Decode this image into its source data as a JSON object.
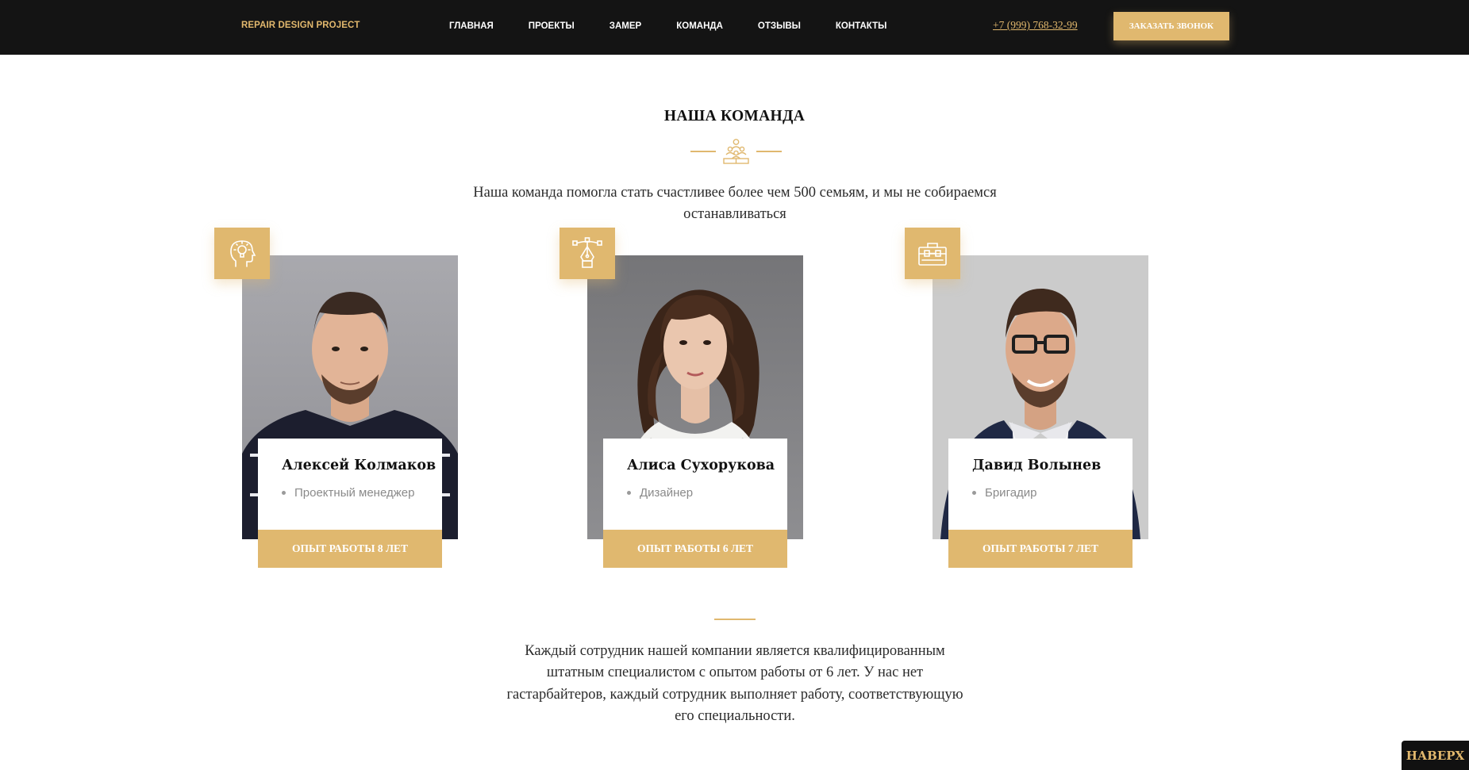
{
  "header": {
    "logo": "REPAIR DESIGN PROJECT",
    "nav": [
      "ГЛАВНАЯ",
      "ПРОЕКТЫ",
      "ЗАМЕР",
      "КОМАНДА",
      "ОТЗЫВЫ",
      "КОНТАКТЫ"
    ],
    "phone": "+7 (999) 768-32-99",
    "call_button": "ЗАКАЗАТЬ ЗВОНОК"
  },
  "section": {
    "title": "НАША КОМАНДА",
    "divider_icon": "team-icon",
    "intro": "Наша команда помогла стать счастливее более чем 500 семьям, и мы не собираемся останавливаться"
  },
  "team": [
    {
      "name": "Алексей Колмаков",
      "role": "Проектный менеджер",
      "experience": "ОПЫТ РАБОТЫ 8 ЛЕТ",
      "badge_icon": "idea-head-icon"
    },
    {
      "name": "Алиса Сухорукова",
      "role": "Дизайнер",
      "experience": "ОПЫТ РАБОТЫ 6 ЛЕТ",
      "badge_icon": "pen-tool-icon"
    },
    {
      "name": "Давид Волынев",
      "role": "Бригадир",
      "experience": "ОПЫТ РАБОТЫ 7 ЛЕТ",
      "badge_icon": "toolbox-icon"
    }
  ],
  "outro": "Каждый сотрудник нашей компании является квалифицированным штатным специалистом с опытом работы от 6 лет. У нас нет гастарбайтеров, каждый сотрудник выполняет работу, соответствующую его специальности.",
  "to_top": "НАВЕРХ",
  "colors": {
    "accent": "#e0b86f",
    "header_bg": "#141414",
    "text": "#111111",
    "muted": "#8a8a8a"
  }
}
